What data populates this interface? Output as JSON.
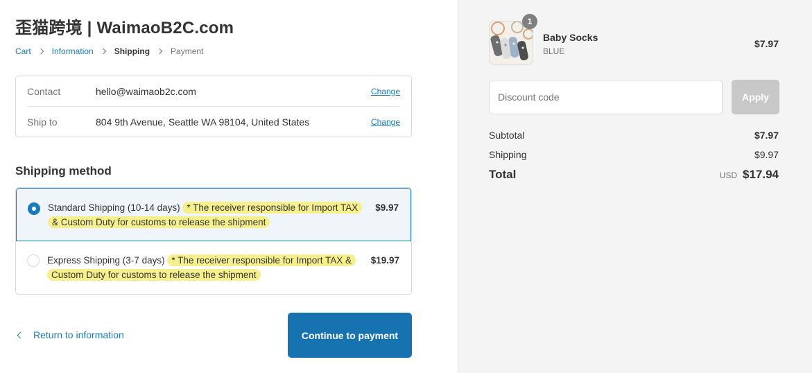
{
  "header": {
    "store_name": "歪猫跨境 | WaimaoB2C.com"
  },
  "breadcrumb": {
    "items": [
      {
        "label": "Cart",
        "state": "link"
      },
      {
        "label": "Information",
        "state": "link"
      },
      {
        "label": "Shipping",
        "state": "current"
      },
      {
        "label": "Payment",
        "state": "upcoming"
      }
    ]
  },
  "review": {
    "contact_label": "Contact",
    "contact_value": "hello@waimaob2c.com",
    "ship_to_label": "Ship to",
    "ship_to_value": "804 9th Avenue, Seattle WA 98104, United States",
    "change_label": "Change"
  },
  "shipping_method": {
    "title": "Shipping method",
    "options": [
      {
        "name": "Standard Shipping (10-14 days)",
        "note_line1": "* The receiver responsible for Import TAX",
        "note_line2": "& Custom Duty for customs to release the shipment",
        "price": "$9.97",
        "selected": true
      },
      {
        "name": "Express Shipping (3-7 days)",
        "note_line1": "* The receiver responsible for Import TAX &",
        "note_line2": "Custom Duty for customs to release the shipment",
        "price": "$19.97",
        "selected": false
      }
    ]
  },
  "footer": {
    "return_label": "Return to information",
    "continue_label": "Continue to payment"
  },
  "order_summary": {
    "product": {
      "name": "Baby Socks",
      "variant": "BLUE",
      "price": "$7.97",
      "quantity": "1"
    },
    "discount": {
      "placeholder": "Discount code",
      "apply_label": "Apply"
    },
    "subtotal_label": "Subtotal",
    "subtotal_value": "$7.97",
    "shipping_label": "Shipping",
    "shipping_value": "$9.97",
    "total_label": "Total",
    "currency": "USD",
    "total_value": "$17.94"
  },
  "colors": {
    "accent": "#197bbd",
    "button": "#1773b0",
    "highlight": "#f6f08c",
    "sidebar_bg": "#f4f4f4",
    "apply_disabled": "#c8c8c8"
  }
}
